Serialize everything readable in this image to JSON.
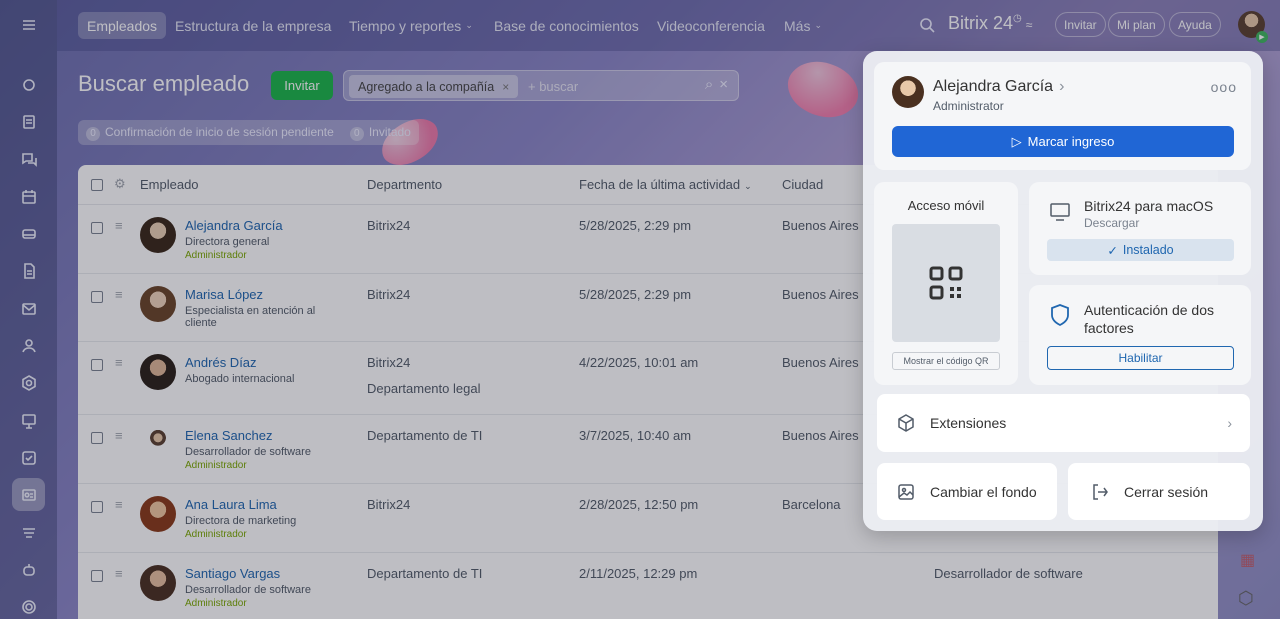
{
  "topbar": {
    "nav": [
      "Empleados",
      "Estructura de la empresa",
      "Tiempo y reportes",
      "Base de conocimientos",
      "Videoconferencia",
      "Más"
    ],
    "brand": "Bitrix 24",
    "invite": "Invitar",
    "plan": "Mi plan",
    "help": "Ayuda"
  },
  "page": {
    "title": "Buscar empleado",
    "invite_button": "Invitar",
    "filter_chip": "Agregado a la compañía",
    "search_placeholder": "+ buscar",
    "counters": [
      {
        "count": "0",
        "label": "Confirmación de inicio de sesión pendiente"
      },
      {
        "count": "0",
        "label": "Invitado"
      }
    ]
  },
  "table": {
    "headers": {
      "employee": "Empleado",
      "department": "Departmento",
      "last_activity": "Fecha de la última actividad",
      "city": "Ciudad"
    },
    "rows": [
      {
        "name": "Alejandra García",
        "position": "Directora general",
        "role": "Administrador",
        "department": "Bitrix24",
        "department2": "",
        "date": "5/28/2025, 2:29 pm",
        "city": "Buenos Aires"
      },
      {
        "name": "Marisa López",
        "position": "Especialista en atención al cliente",
        "role": "",
        "department": "Bitrix24",
        "department2": "",
        "date": "5/28/2025, 2:29 pm",
        "city": "Buenos Aires"
      },
      {
        "name": "Andrés Díaz",
        "position": "Abogado internacional",
        "role": "",
        "department": "Bitrix24",
        "department2": "Departamento legal",
        "date": "4/22/2025, 10:01 am",
        "city": "Buenos Aires"
      },
      {
        "name": "Elena Sanchez",
        "position": "Desarrollador de software",
        "role": "Administrador",
        "department": "Departamento de TI",
        "department2": "",
        "date": "3/7/2025, 10:40 am",
        "city": "Buenos Aires"
      },
      {
        "name": "Ana Laura Lima",
        "position": "Directora de marketing",
        "role": "Administrador",
        "department": "Bitrix24",
        "department2": "",
        "date": "2/28/2025, 12:50 pm",
        "city": "Barcelona"
      },
      {
        "name": "Santiago Vargas",
        "position": "Desarrollador de software",
        "role": "Administrador",
        "department": "Departamento de TI",
        "department2": "",
        "date": "2/11/2025, 12:29 pm",
        "city": "",
        "extra": "Desarrollador de software"
      }
    ]
  },
  "panel": {
    "user_name": "Alejandra García",
    "user_role": "Administrator",
    "checkin_button": "Marcar ingreso",
    "mobile_title": "Acceso móvil",
    "qr_button": "Mostrar el código QR",
    "mac_title": "Bitrix24 para macOS",
    "mac_sub": "Descargar",
    "mac_button": "Instalado",
    "tfa_title": "Autenticación de dos factores",
    "tfa_button": "Habilitar",
    "extensions": "Extensiones",
    "change_bg": "Cambiar el fondo",
    "logout": "Cerrar sesión"
  }
}
